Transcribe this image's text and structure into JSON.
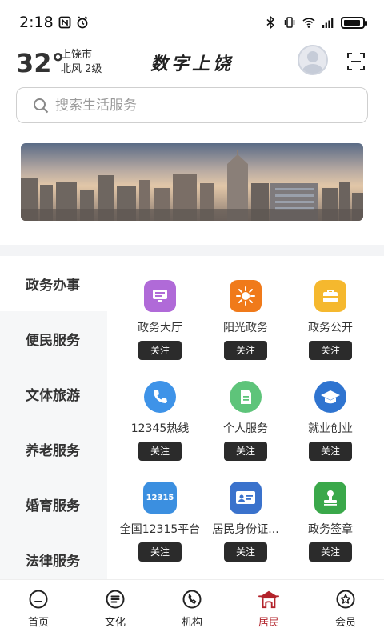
{
  "status_bar": {
    "time": "2:18"
  },
  "header": {
    "temperature": "32°",
    "city": "上饶市",
    "wind": "北风 2级",
    "brand": "数字上饶"
  },
  "search": {
    "placeholder": "搜索生活服务"
  },
  "categories": [
    {
      "label": "政务办事",
      "active": true
    },
    {
      "label": "便民服务",
      "active": false
    },
    {
      "label": "文体旅游",
      "active": false
    },
    {
      "label": "养老服务",
      "active": false
    },
    {
      "label": "婚育服务",
      "active": false
    },
    {
      "label": "法律服务",
      "active": false
    }
  ],
  "services": [
    {
      "label": "政务大厅",
      "icon": "monitor-icon",
      "color": "#b06ad8",
      "follow": "关注"
    },
    {
      "label": "阳光政务",
      "icon": "sun-icon",
      "color": "#f07a1a",
      "follow": "关注"
    },
    {
      "label": "政务公开",
      "icon": "briefcase-icon",
      "color": "#f5b82e",
      "follow": "关注"
    },
    {
      "label": "12345热线",
      "icon": "phone-icon",
      "color": "#3e93e8",
      "follow": "关注"
    },
    {
      "label": "个人服务",
      "icon": "document-icon",
      "color": "#5ec47a",
      "follow": "关注"
    },
    {
      "label": "就业创业",
      "icon": "graduation-cap-icon",
      "color": "#2f74d0",
      "follow": "关注"
    },
    {
      "label": "全国12315平台",
      "icon": "badge-12315-icon",
      "badge_text": "12315",
      "color": "#3b8fe0",
      "follow": "关注"
    },
    {
      "label": "居民身份证...",
      "icon": "id-card-icon",
      "color": "#3a72cc",
      "follow": "关注"
    },
    {
      "label": "政务签章",
      "icon": "stamp-icon",
      "color": "#3aa84a",
      "follow": "关注"
    }
  ],
  "tabs": [
    {
      "label": "首页",
      "icon": "home-icon",
      "active": false
    },
    {
      "label": "文化",
      "icon": "culture-icon",
      "active": false
    },
    {
      "label": "机构",
      "icon": "institution-icon",
      "active": false
    },
    {
      "label": "居民",
      "icon": "resident-icon",
      "active": true
    },
    {
      "label": "会员",
      "icon": "member-icon",
      "active": false
    }
  ],
  "colors": {
    "accent": "#b3232b",
    "follow_button": "#2b2b2b"
  }
}
